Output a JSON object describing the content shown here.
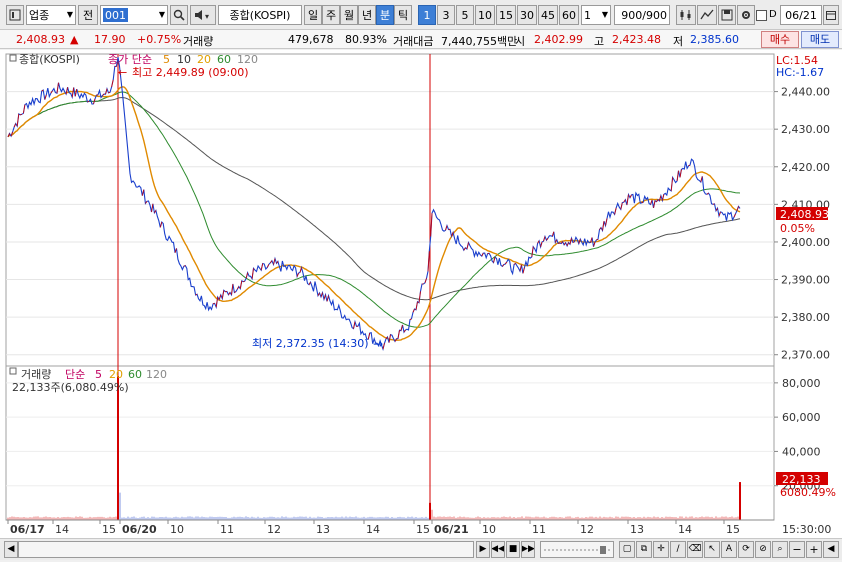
{
  "toolbar": {
    "market": "업종",
    "scope": "전",
    "code": "001",
    "index_name": "종합(KOSPI)",
    "periods": [
      "일",
      "주",
      "월",
      "년",
      "분",
      "틱"
    ],
    "active_period": "분",
    "intervals": [
      "1",
      "3",
      "5",
      "10",
      "15",
      "30",
      "45",
      "60"
    ],
    "active_interval": "1",
    "interval_select": "1",
    "count": "900",
    "count_max": "/900",
    "date": "06/21"
  },
  "quote": {
    "price": "2,408.93",
    "change_arrow": "▲",
    "change": "17.90",
    "change_pct": "+0.75%",
    "volume_label": "거래량",
    "volume": "479,678",
    "volume_ratio": "80.93%",
    "turnover_label": "거래대금",
    "turnover": "7,440,755백만",
    "open_label": "시",
    "open": "2,402.99",
    "high_label": "고",
    "high": "2,423.48",
    "low_label": "저",
    "low": "2,385.60",
    "buy_label": "매수",
    "sell_label": "매도"
  },
  "price_panel": {
    "title": "종합(KOSPI)",
    "legend_prefix": "종가 단순",
    "ma_periods": [
      "5",
      "10",
      "20",
      "60",
      "120"
    ],
    "high_note": "최고 2,449.89 (09:00)",
    "low_note": "최저 2,372.35 (14:30)",
    "lc": "LC:1.54",
    "hc": "HC:-1.67",
    "last_price": "2,408.93",
    "last_pct": "0.05%",
    "y_ticks": [
      "2,440.00",
      "2,430.00",
      "2,420.00",
      "2,410.00",
      "2,400.00",
      "2,390.00",
      "2,380.00",
      "2,370.00"
    ]
  },
  "volume_panel": {
    "title": "거래량",
    "legend_prefix": "단순",
    "ma_periods": [
      "5",
      "20",
      "60",
      "120"
    ],
    "note": "22,133주(6,080.49%)",
    "last_volume": "22,133",
    "last_pct": "6080.49%",
    "y_ticks": [
      "80,000",
      "60,000",
      "40,000",
      "20,000"
    ]
  },
  "x_axis": {
    "labels": [
      "06/17",
      "14",
      "15",
      "06/20",
      "10",
      "11",
      "12",
      "13",
      "14",
      "15",
      "06/21",
      "10",
      "11",
      "12",
      "13",
      "14",
      "15"
    ],
    "time": "15:30:00"
  },
  "colors": {
    "price_line": "#1a3fcc",
    "ma5": "#e08a00",
    "ma20": "#2e8b2e",
    "ma60": "#555555",
    "accent_red": "#d40000",
    "accent_blue": "#0033cc"
  },
  "chart_data": {
    "type": "line",
    "title": "종합(KOSPI)",
    "x": [
      "06/17 13:40",
      "06/17 14:00",
      "06/17 14:30",
      "06/17 15:00",
      "06/17 15:20",
      "06/20 09:00",
      "06/20 09:20",
      "06/20 09:40",
      "06/20 10:00",
      "06/20 10:30",
      "06/20 11:00",
      "06/20 11:30",
      "06/20 12:00",
      "06/20 12:30",
      "06/20 13:00",
      "06/20 13:30",
      "06/20 14:00",
      "06/20 14:30",
      "06/20 15:00",
      "06/20 15:20",
      "06/21 09:00",
      "06/21 09:20",
      "06/21 09:40",
      "06/21 10:00",
      "06/21 10:30",
      "06/21 11:00",
      "06/21 11:30",
      "06/21 12:00",
      "06/21 12:30",
      "06/21 13:00",
      "06/21 13:30",
      "06/21 14:00",
      "06/21 14:20",
      "06/21 14:40",
      "06/21 15:00",
      "06/21 15:20"
    ],
    "series": [
      {
        "values": [
          2428,
          2437,
          2441,
          2438,
          2440,
          2449.89,
          2418,
          2410,
          2398,
          2385,
          2383,
          2387,
          2392,
          2394,
          2392,
          2384,
          2378,
          2372.35,
          2378,
          2392,
          2408,
          2402,
          2398,
          2396,
          2392,
          2402,
          2400,
          2400,
          2408,
          2412,
          2410,
          2418,
          2422,
          2412,
          2406,
          2408.93
        ]
      }
    ],
    "ylim": [
      2367,
      2450
    ],
    "volume": {
      "y_ticks": [
        0,
        20000,
        40000,
        60000,
        80000
      ],
      "last": 22133
    }
  }
}
